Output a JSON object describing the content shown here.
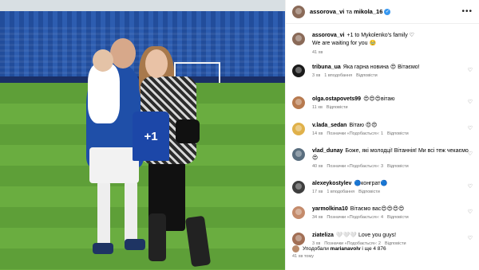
{
  "post": {
    "author1": "assorova_vi",
    "connector": "та",
    "author2": "mikola_16",
    "more_icon": "more-horizontal-icon",
    "photo_shirt_text": "+1"
  },
  "caption": {
    "user": "assorova_vi",
    "text": "+1 to Mykolenko's family ♡",
    "text2": "We are waiting for you 🥹",
    "time": "41 хв"
  },
  "comments": [
    {
      "user": "tribuna_ua",
      "text": "Яка гарна новина 😍 Вітаємо!",
      "time": "3 хв",
      "likes": "1 вподобання",
      "reply": "Відповісти",
      "avatar_color": "#1a1a1a"
    },
    {
      "user": "olga.ostapovets99",
      "text": "😍😍😍вітаю",
      "time": "11 хв",
      "likes": "",
      "reply": "Відповісти",
      "avatar_color": "#b77a4f"
    },
    {
      "user": "v.lada_sedan",
      "text": "Вітаю 😍😍",
      "time": "14 хв",
      "likes": "Позначки «Подобається»: 1",
      "reply": "Відповісти",
      "avatar_color": "#e0b14a"
    },
    {
      "user": "vlad_dunay",
      "text": "Боже, які молодці! Вітаннія! Ми всі теж чекаємо 😍",
      "time": "40 хв",
      "likes": "Позначки «Подобається»: 3",
      "reply": "Відповісти",
      "avatar_color": "#5a6e7f"
    },
    {
      "user": "alexeykostylev",
      "text": "🔵конграт🔵",
      "time": "17 хв",
      "likes": "1 вподобання",
      "reply": "Відповісти",
      "avatar_color": "#3e3e3e"
    },
    {
      "user": "yarmolkina10",
      "text": "Вітаємо вас😍😍😍😍",
      "time": "34 хв",
      "likes": "Позначки «Подобається»: 4",
      "reply": "Відповісти",
      "avatar_color": "#c48b6b"
    },
    {
      "user": "ziateliza",
      "text": "🤍🤍🤍 Love you guys!",
      "time": "3 хв",
      "likes": "Позначки «Подобається»: 2",
      "reply": "Відповісти",
      "avatar_color": "#a26f55"
    }
  ],
  "footer": {
    "liked_prefix": "Уподобали",
    "liked_user": "marianavolv",
    "liked_suffix": "і ще 4 876",
    "time": "41 хв тому"
  },
  "colors": {
    "verified": "#3797f0",
    "meta_gray": "#737373"
  }
}
